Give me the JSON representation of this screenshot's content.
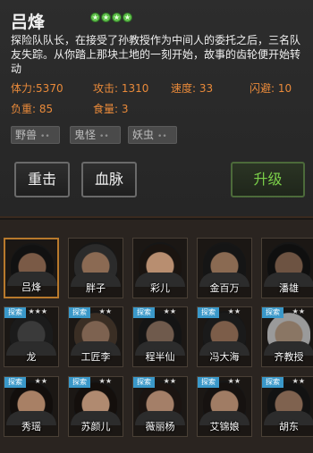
{
  "hero": {
    "name": "吕烽",
    "star_count": 4,
    "description": "探险队队长，在接受了孙教授作为中间人的委托之后，三名队友失踪。从你踏上那块土地的一刻开始，故事的齿轮便开始转动",
    "stats": {
      "hp": "体力:5370",
      "attack": "攻击: 1310",
      "speed": "速度: 33",
      "dodge": "闪避: 10",
      "load": "负重: 85",
      "food": "食量: 3"
    },
    "tags": [
      "野兽",
      "鬼怪",
      "妖虫"
    ]
  },
  "buttons": {
    "strike": "重击",
    "bloodline": "血脉",
    "upgrade": "升级"
  },
  "roster": [
    {
      "name": "吕烽",
      "badge": "",
      "stars": "",
      "selected": true,
      "skin": "#7a5a46",
      "hair": "#111"
    },
    {
      "name": "胖子",
      "badge": "",
      "stars": "",
      "selected": false,
      "skin": "#8b6a53",
      "hair": "#2b2b2b"
    },
    {
      "name": "彩儿",
      "badge": "",
      "stars": "",
      "selected": false,
      "skin": "#b88e70",
      "hair": "#1a1410"
    },
    {
      "name": "金百万",
      "badge": "",
      "stars": "",
      "selected": false,
      "skin": "#8a6a52",
      "hair": "#151515"
    },
    {
      "name": "潘雄",
      "badge": "",
      "stars": "",
      "selected": false,
      "skin": "#6d5342",
      "hair": "#0f0f0f"
    },
    {
      "name": "龙",
      "badge": "探索",
      "stars": "★★★",
      "selected": false,
      "skin": "#3a3a3a",
      "hair": "#1b1b1b"
    },
    {
      "name": "工匠李",
      "badge": "探索",
      "stars": "★★",
      "selected": false,
      "skin": "#7d6250",
      "hair": "#3a2e24"
    },
    {
      "name": "程半仙",
      "badge": "探索",
      "stars": "★★",
      "selected": false,
      "skin": "#6f5a4c",
      "hair": "#141414"
    },
    {
      "name": "冯大海",
      "badge": "探索",
      "stars": "★★",
      "selected": false,
      "skin": "#7c5d49",
      "hair": "#1a1a1a"
    },
    {
      "name": "齐教授",
      "badge": "探索",
      "stars": "★★",
      "selected": false,
      "skin": "#8a7664",
      "hair": "#9a9a9a"
    },
    {
      "name": "秀瑶",
      "badge": "探索",
      "stars": "★★",
      "selected": false,
      "skin": "#a88065",
      "hair": "#120e0c"
    },
    {
      "name": "苏颜儿",
      "badge": "探索",
      "stars": "★★",
      "selected": false,
      "skin": "#b08a70",
      "hair": "#140f0c"
    },
    {
      "name": "薇丽杨",
      "badge": "探索",
      "stars": "★★",
      "selected": false,
      "skin": "#a47f68",
      "hair": "#1b1411"
    },
    {
      "name": "艾锦娘",
      "badge": "探索",
      "stars": "★★",
      "selected": false,
      "skin": "#a07c64",
      "hair": "#161210"
    },
    {
      "name": "胡东",
      "badge": "探索",
      "stars": "★★",
      "selected": false,
      "skin": "#7f624f",
      "hair": "#121212"
    }
  ]
}
